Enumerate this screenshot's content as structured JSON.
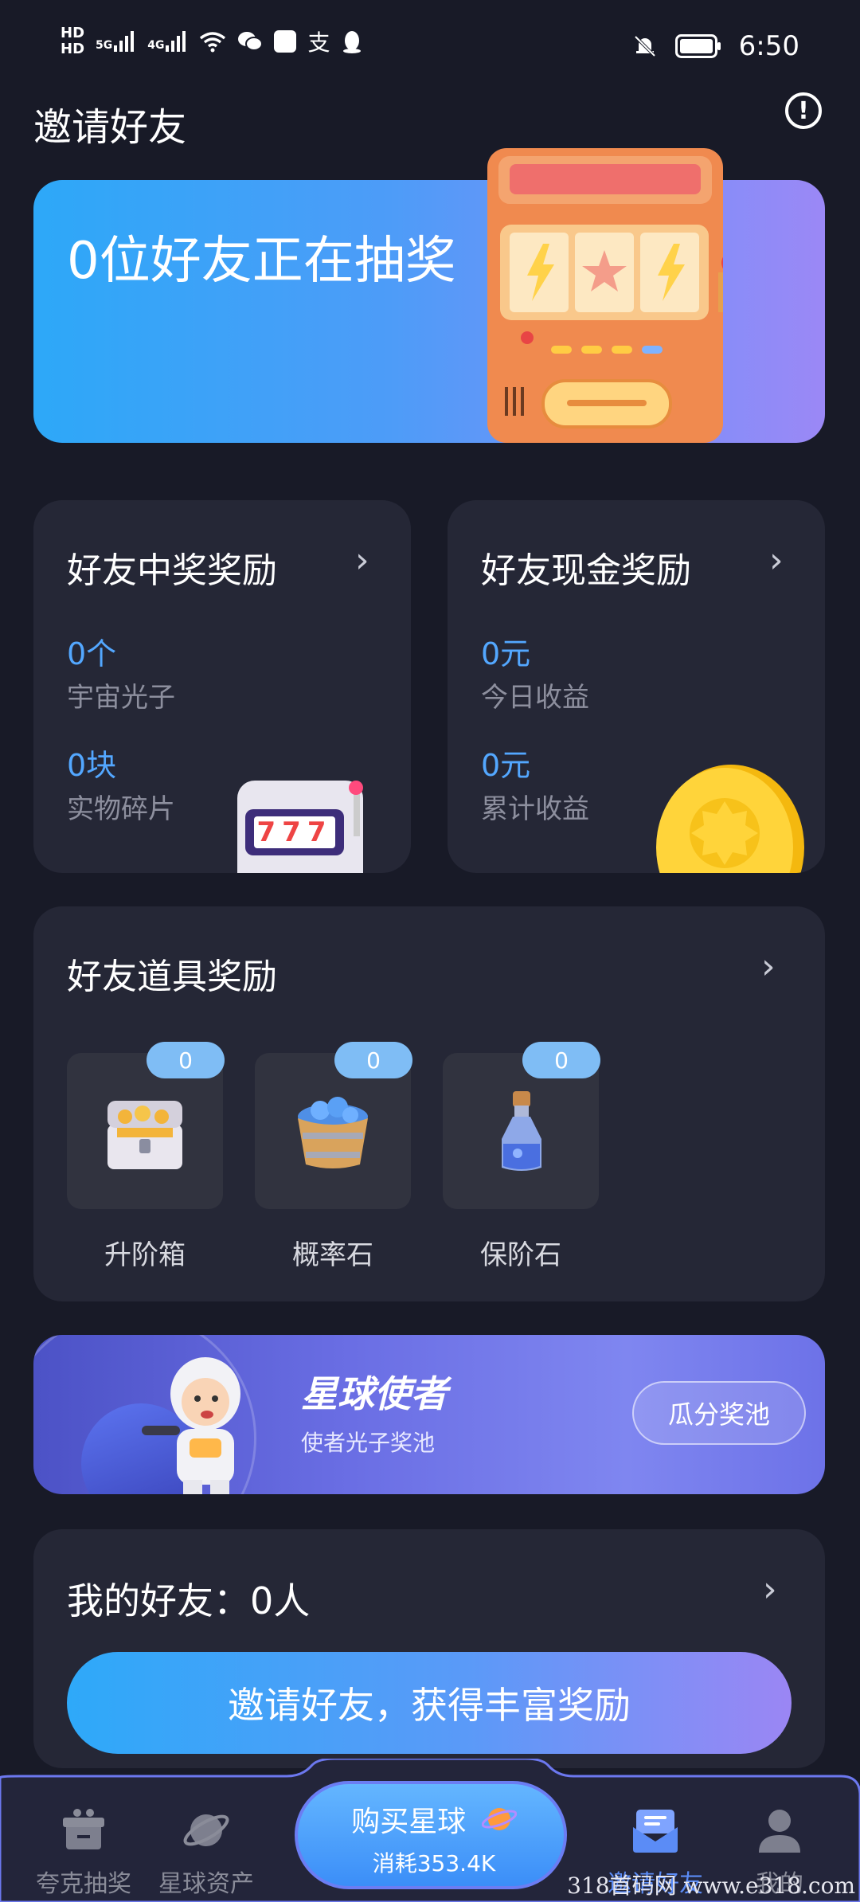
{
  "status_bar": {
    "hd1": "HD",
    "hd2": "HD",
    "net1": "5G",
    "net2": "4G",
    "app_text": "支",
    "time": "6:50"
  },
  "header": {
    "title": "邀请好友"
  },
  "banner": {
    "text": "0位好友正在抽奖"
  },
  "lottery_card": {
    "title": "好友中奖奖励",
    "stat1_value": "0个",
    "stat1_label": "宇宙光子",
    "stat2_value": "0块",
    "stat2_label": "实物碎片",
    "slot_digits": "777"
  },
  "cash_card": {
    "title": "好友现金奖励",
    "stat1_value": "0元",
    "stat1_label": "今日收益",
    "stat2_value": "0元",
    "stat2_label": "累计收益"
  },
  "props_card": {
    "title": "好友道具奖励",
    "items": [
      {
        "label": "升阶箱",
        "count": "0"
      },
      {
        "label": "概率石",
        "count": "0"
      },
      {
        "label": "保阶石",
        "count": "0"
      }
    ]
  },
  "promo": {
    "title": "星球使者",
    "subtitle": "使者光子奖池",
    "button": "瓜分奖池"
  },
  "friends": {
    "title": "我的好友：0人",
    "invite_button": "邀请好友，获得丰富奖励"
  },
  "tabbar": {
    "tabs": [
      {
        "label": "夸克抽奖",
        "icon": "gift-icon",
        "active": false
      },
      {
        "label": "星球资产",
        "icon": "planet-icon",
        "active": false
      },
      {
        "label": "邀请好友",
        "icon": "envelope-icon",
        "active": true
      },
      {
        "label": "我的",
        "icon": "person-icon",
        "active": false
      }
    ],
    "center_line1": "购买星球",
    "center_line2": "消耗353.4K"
  },
  "watermark": "318首码网 www.e318.com",
  "colors": {
    "background": "#181a27",
    "card": "#252736",
    "accent_blue": "#53a7ff",
    "active_tab": "#5b8cf6"
  }
}
